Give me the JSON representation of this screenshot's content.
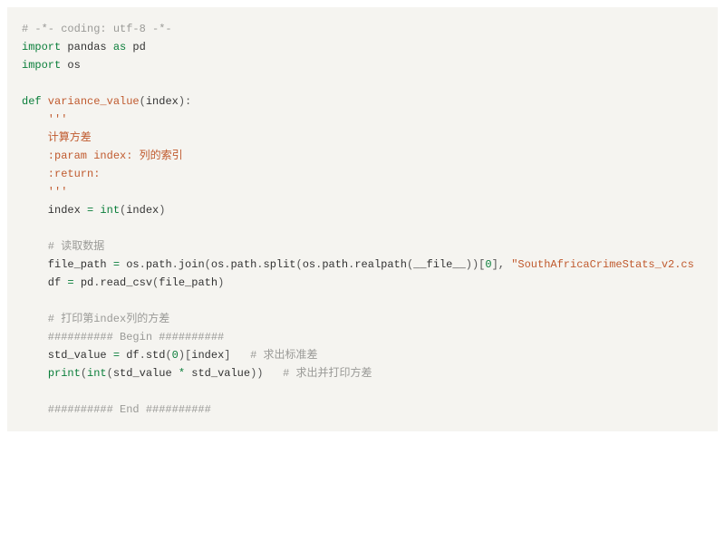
{
  "code": {
    "line1_comment": "# -*- coding: utf-8 -*-",
    "line2_kw_import1": "import",
    "line2_name_pandas": " pandas ",
    "line2_kw_as": "as",
    "line2_name_pd": " pd",
    "line3_kw_import2": "import",
    "line3_name_os": " os",
    "line5_kw_def": "def",
    "line5_fname": " variance_value",
    "line5_paren_open": "(",
    "line5_param": "index",
    "line5_paren_close_colon": "):",
    "line6_docq1": "    '''",
    "line7_doc": "    计算方差",
    "line8_doc": "    :param index: 列的索引",
    "line9_doc": "    :return:",
    "line10_docq2": "    '''",
    "line11_indent": "    index ",
    "line11_eq": "=",
    "line11_sp": " ",
    "line11_int": "int",
    "line11_po": "(",
    "line11_arg": "index",
    "line11_pc": ")",
    "line13_comment": "    # 读取数据",
    "line14_text1": "    file_path ",
    "line14_eq": "=",
    "line14_text2": " os",
    "line14_dot1": ".",
    "line14_path1": "path",
    "line14_dot2": ".",
    "line14_join": "join",
    "line14_po1": "(",
    "line14_os2": "os",
    "line14_dot3": ".",
    "line14_path2": "path",
    "line14_dot4": ".",
    "line14_split": "split",
    "line14_po2": "(",
    "line14_os3": "os",
    "line14_dot5": ".",
    "line14_path3": "path",
    "line14_dot6": ".",
    "line14_realpath": "realpath",
    "line14_po3": "(",
    "line14_file": "__file__",
    "line14_pc3": "))[",
    "line14_zero": "0",
    "line14_brc": "], ",
    "line14_str": "\"SouthAfricaCrimeStats_v2.cs",
    "line15_text1": "    df ",
    "line15_eq": "=",
    "line15_text2": " pd",
    "line15_dot": ".",
    "line15_read": "read_csv",
    "line15_po": "(",
    "line15_arg": "file_path",
    "line15_pc": ")",
    "line17_comment": "    # 打印第index列的方差",
    "line18_comment": "    ########## Begin ##########",
    "line19_text1": "    std_value ",
    "line19_eq": "=",
    "line19_text2": " df",
    "line19_dot": ".",
    "line19_std": "std",
    "line19_po1": "(",
    "line19_zero": "0",
    "line19_pc1": ")[",
    "line19_idx": "index",
    "line19_brc": "]   ",
    "line19_comment": "# 求出标准差",
    "line20_indent": "    ",
    "line20_print": "print",
    "line20_po1": "(",
    "line20_int": "int",
    "line20_po2": "(",
    "line20_sv1": "std_value ",
    "line20_mul": "*",
    "line20_sv2": " std_value",
    "line20_pc": "))   ",
    "line20_comment": "# 求出并打印方差",
    "line22_comment": "    ########## End ##########"
  }
}
